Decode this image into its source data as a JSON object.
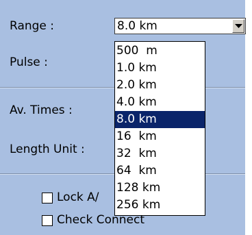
{
  "form": {
    "range_label": "Range :",
    "pulse_label": "Pulse :",
    "av_times_label": "Av. Times :",
    "length_unit_label": "Length Unit :",
    "lock_label": "Lock A/",
    "check_connect_label": "Check Connect"
  },
  "range_combo": {
    "value": "8.0 km",
    "options": [
      "500  m",
      "1.0 km",
      "2.0 km",
      "4.0 km",
      "8.0 km",
      "16  km",
      "32  km",
      "64  km",
      "128 km",
      "256 km"
    ],
    "selected_index": 4
  },
  "checkboxes": {
    "lock_checked": false,
    "check_connect_checked": false
  },
  "colors": {
    "panel_bg": "#a9bfe1",
    "selection_bg": "#0a246a",
    "selection_fg": "#ffffff"
  },
  "icons": {
    "combo_arrow": "chevron-down-icon"
  }
}
